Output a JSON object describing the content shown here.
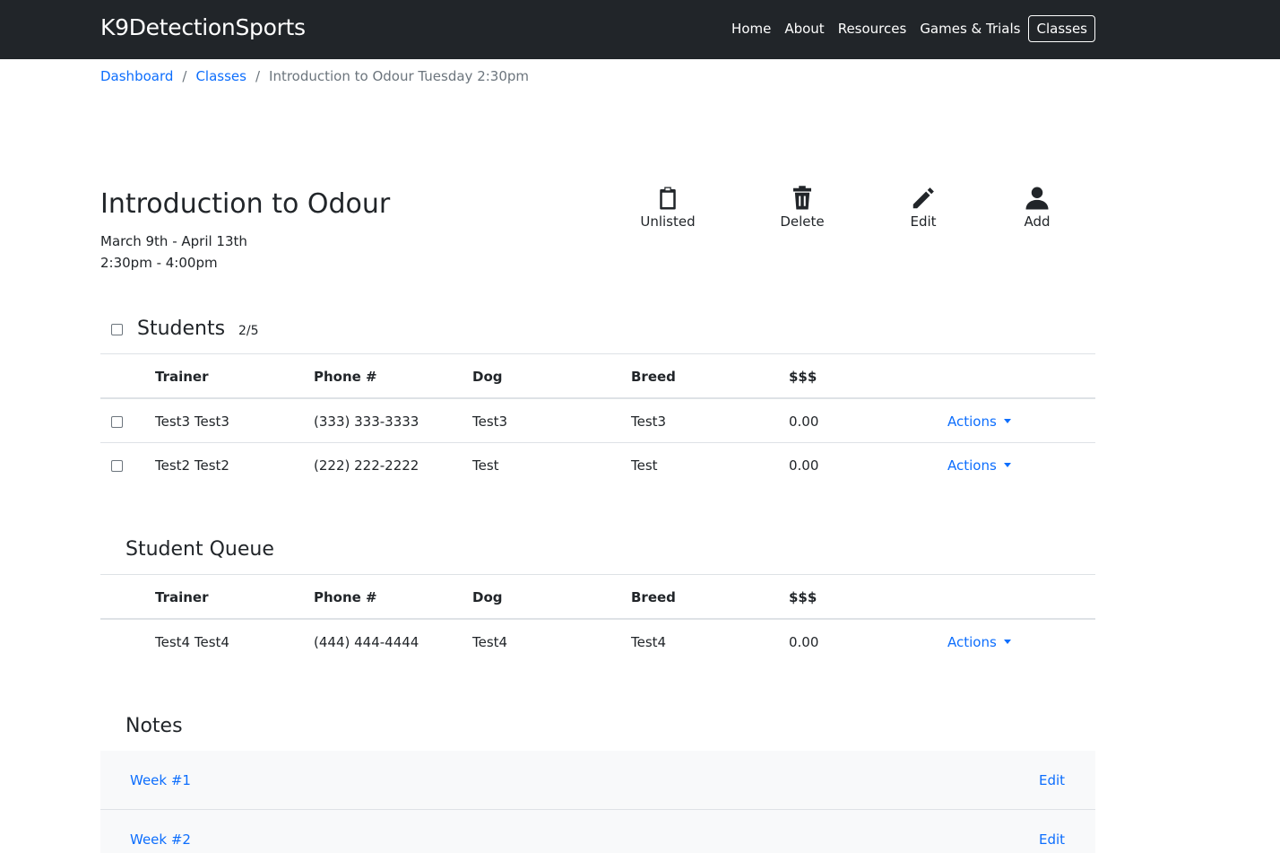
{
  "navbar": {
    "brand": "K9DetectionSports",
    "links": [
      "Home",
      "About",
      "Resources",
      "Games & Trials",
      "Classes"
    ],
    "active": "Classes"
  },
  "breadcrumb": {
    "items": [
      "Dashboard",
      "Classes"
    ],
    "current": "Introduction to Odour Tuesday 2:30pm",
    "separator": "/"
  },
  "class": {
    "title": "Introduction to Odour",
    "dates": "March 9th - April 13th",
    "time": "2:30pm - 4:00pm"
  },
  "toolbar": {
    "unlisted": {
      "label": "Unlisted",
      "icon": "clipboard-icon"
    },
    "delete": {
      "label": "Delete",
      "icon": "trash-icon"
    },
    "edit": {
      "label": "Edit",
      "icon": "pencil-icon"
    },
    "add": {
      "label": "Add",
      "icon": "person-icon"
    }
  },
  "students": {
    "title": "Students",
    "count": "2/5",
    "headers": [
      "Trainer",
      "Phone #",
      "Dog",
      "Breed",
      "$$$"
    ],
    "rows": [
      {
        "trainer": "Test3 Test3",
        "phone": "(333) 333-3333",
        "dog": "Test3",
        "breed": "Test3",
        "amount": "0.00",
        "action": "Actions"
      },
      {
        "trainer": "Test2 Test2",
        "phone": "(222) 222-2222",
        "dog": "Test",
        "breed": "Test",
        "amount": "0.00",
        "action": "Actions"
      }
    ]
  },
  "queue": {
    "title": "Student Queue",
    "headers": [
      "Trainer",
      "Phone #",
      "Dog",
      "Breed",
      "$$$"
    ],
    "rows": [
      {
        "trainer": "Test4 Test4",
        "phone": "(444) 444-4444",
        "dog": "Test4",
        "breed": "Test4",
        "amount": "0.00",
        "action": "Actions"
      }
    ]
  },
  "notes": {
    "title": "Notes",
    "items": [
      {
        "label": "Week #1",
        "edit": "Edit"
      },
      {
        "label": "Week #2",
        "edit": "Edit"
      }
    ]
  },
  "colors": {
    "navbar": "#212529",
    "link": "#0d6efd",
    "muted": "#6c757d",
    "note_bg": "#f8f9fa"
  }
}
